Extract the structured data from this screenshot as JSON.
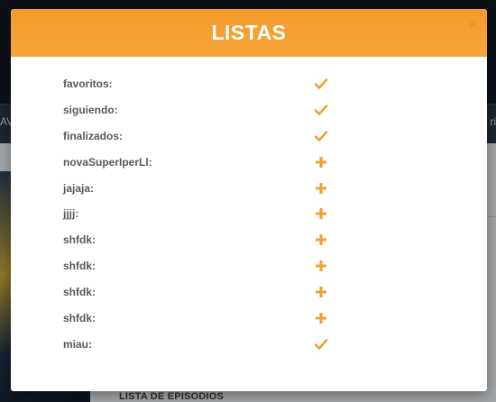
{
  "background": {
    "nav_left": "AV",
    "nav_right": "ri",
    "section_title": "LISTA DE EPISODIOS"
  },
  "modal": {
    "title": "LISTAS",
    "close_label": "×",
    "accent_color": "#f39a2a",
    "lists": [
      {
        "label": "favoritos:",
        "status": "added",
        "icon": "checkmark-icon"
      },
      {
        "label": "siguiendo:",
        "status": "added",
        "icon": "checkmark-icon"
      },
      {
        "label": "finalizados:",
        "status": "added",
        "icon": "checkmark-icon"
      },
      {
        "label": "novaSuperIperLl:",
        "status": "not-added",
        "icon": "plus-icon"
      },
      {
        "label": "jajaja:",
        "status": "not-added",
        "icon": "plus-icon"
      },
      {
        "label": "jjjj:",
        "status": "not-added",
        "icon": "plus-icon"
      },
      {
        "label": "shfdk:",
        "status": "not-added",
        "icon": "plus-icon"
      },
      {
        "label": "shfdk:",
        "status": "not-added",
        "icon": "plus-icon"
      },
      {
        "label": "shfdk:",
        "status": "not-added",
        "icon": "plus-icon"
      },
      {
        "label": "shfdk:",
        "status": "not-added",
        "icon": "plus-icon"
      },
      {
        "label": "miau:",
        "status": "added",
        "icon": "checkmark-icon"
      }
    ]
  }
}
